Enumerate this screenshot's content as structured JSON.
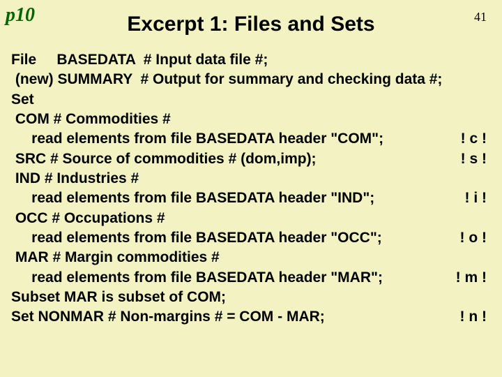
{
  "page_ref": "p10",
  "page_num": "41",
  "title": "Excerpt 1:  Files and Sets",
  "lines": [
    {
      "left": "File     BASEDATA  # Input data file #;",
      "right": ""
    },
    {
      "left": " (new) SUMMARY  # Output for summary and checking data #;",
      "right": ""
    },
    {
      "left": "Set",
      "right": ""
    },
    {
      "left": " COM # Commodities #",
      "right": ""
    },
    {
      "left": "     read elements from file BASEDATA header \"COM\";",
      "right": "! c !"
    },
    {
      "left": " SRC # Source of commodities # (dom,imp);",
      "right": "! s !"
    },
    {
      "left": " IND # Industries #",
      "right": ""
    },
    {
      "left": "     read elements from file BASEDATA header \"IND\";",
      "right": "! i !"
    },
    {
      "left": " OCC # Occupations #",
      "right": ""
    },
    {
      "left": "     read elements from file BASEDATA header \"OCC\";",
      "right": "! o !"
    },
    {
      "left": " MAR # Margin commodities #",
      "right": ""
    },
    {
      "left": "     read elements from file BASEDATA header \"MAR\";",
      "right": "! m !"
    },
    {
      "left": "Subset MAR is subset of COM;",
      "right": ""
    },
    {
      "left": "Set NONMAR # Non-margins # = COM - MAR;",
      "right": "! n !"
    }
  ]
}
